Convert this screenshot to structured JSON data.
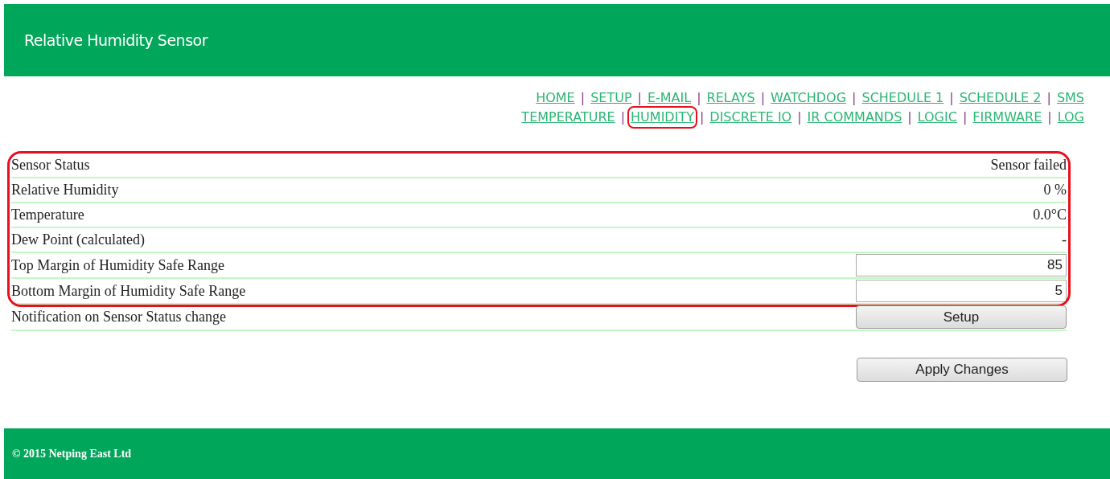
{
  "header": {
    "title": "Relative Humidity Sensor"
  },
  "nav": {
    "lines": [
      {
        "links": [
          {
            "label": "HOME",
            "sep": "|",
            "highlighted": false
          },
          {
            "label": "SETUP",
            "sep": "|",
            "highlighted": false
          },
          {
            "label": "E-MAIL",
            "sep": "|",
            "highlighted": false
          },
          {
            "label": "RELAYS",
            "sep": "|",
            "highlighted": false
          },
          {
            "label": "WATCHDOG",
            "sep": "|",
            "highlighted": false
          },
          {
            "label": "SCHEDULE 1",
            "sep": "|",
            "highlighted": false
          },
          {
            "label": "SCHEDULE 2",
            "sep": "|",
            "highlighted": false
          },
          {
            "label": "SMS",
            "highlighted": false
          }
        ]
      },
      {
        "links": [
          {
            "label": "TEMPERATURE",
            "sep": "|",
            "highlighted": false
          },
          {
            "label": "HUMIDITY",
            "sep": "|",
            "highlighted": true
          },
          {
            "label": "DISCRETE IO",
            "sep": "|",
            "highlighted": false
          },
          {
            "label": "IR COMMANDS",
            "sep": "|",
            "highlighted": false
          },
          {
            "label": "LOGIC",
            "sep": "|",
            "highlighted": false
          },
          {
            "label": "FIRMWARE",
            "sep": "|",
            "highlighted": false
          },
          {
            "label": "LOG",
            "highlighted": false
          }
        ]
      }
    ]
  },
  "sections": [
    {
      "highlighted": true,
      "rows": [
        {
          "kind": "text",
          "label": "Sensor Status",
          "value": "Sensor failed"
        },
        {
          "kind": "text",
          "label": "Relative Humidity",
          "value": "0 %"
        },
        {
          "kind": "text",
          "label": "Temperature",
          "value": "0.0°C"
        },
        {
          "kind": "text",
          "label": "Dew Point (calculated)",
          "value": "-"
        },
        {
          "kind": "input",
          "label": "Top Margin of Humidity Safe Range",
          "value": "85"
        },
        {
          "kind": "input",
          "label": "Bottom Margin of Humidity Safe Range",
          "value": "5"
        }
      ]
    },
    {
      "highlighted": false,
      "rows": [
        {
          "kind": "button",
          "label": "Notification on Sensor Status change",
          "value": "Setup"
        }
      ]
    }
  ],
  "apply_button": "Apply Changes",
  "footer": {
    "text": "© 2015 Netping East Ltd"
  }
}
